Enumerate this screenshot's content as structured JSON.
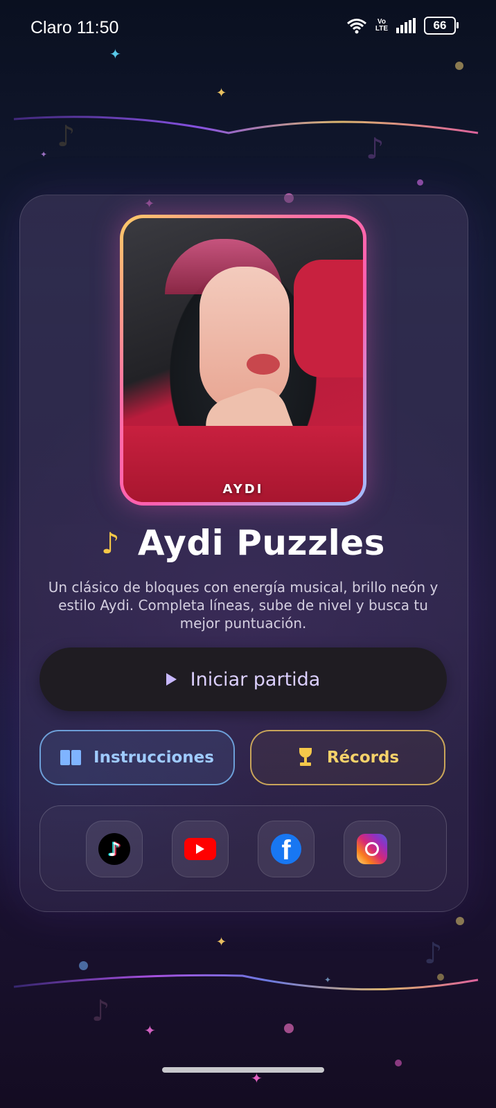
{
  "status_bar": {
    "carrier": "Claro",
    "time": "11:50",
    "network_top": "Vo",
    "network_bottom": "LTE",
    "battery": "66"
  },
  "game": {
    "photo_caption": "AYDI",
    "title": "Aydi Puzzles",
    "title_icon": "music-note-icon",
    "description": "Un clásico de bloques con energía musical, brillo neón y estilo Aydi. Completa líneas, sube de nivel y busca tu mejor puntuación."
  },
  "buttons": {
    "start": "Iniciar partida",
    "instructions": "Instrucciones",
    "records": "Récords"
  },
  "social": [
    "tiktok-icon",
    "youtube-icon",
    "facebook-icon",
    "instagram-icon"
  ],
  "colors": {
    "accent_start": "#dcd0ff",
    "instructions": "#9fcbff",
    "records": "#f5d26a",
    "title_note": "#f6c847"
  }
}
